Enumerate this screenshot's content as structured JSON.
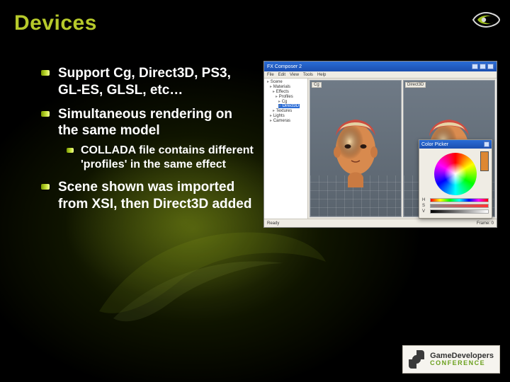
{
  "title": "Devices",
  "bullets": [
    {
      "text": "Support Cg, Direct3D, PS3, GL-ES, GLSL, etc…"
    },
    {
      "text": "Simultaneous rendering on the same model",
      "sub": [
        {
          "text": "COLLADA file contains different 'profiles' in the same effect"
        }
      ]
    },
    {
      "text": "Scene shown was imported from XSI, then Direct3D added"
    }
  ],
  "app": {
    "window_title": "FX Composer 2",
    "menus": [
      "File",
      "Edit",
      "View",
      "Tools",
      "Help"
    ],
    "tree_items": [
      "Scene",
      "Materials",
      "Effects",
      "Profiles",
      "Cg",
      "Direct3D",
      "Textures",
      "Lights",
      "Cameras"
    ],
    "tree_selected": "Direct3D",
    "viewport_labels": [
      "Cg",
      "Direct3D"
    ],
    "status_left": "Ready",
    "status_right": "Frame: 0",
    "palette_title": "Color Picker",
    "slider_labels": [
      "H",
      "S",
      "V"
    ]
  },
  "gdc": {
    "line1": "GameDevelopers",
    "line2": "CONFERENCE"
  },
  "logo_name": "nvidia-eye-icon"
}
